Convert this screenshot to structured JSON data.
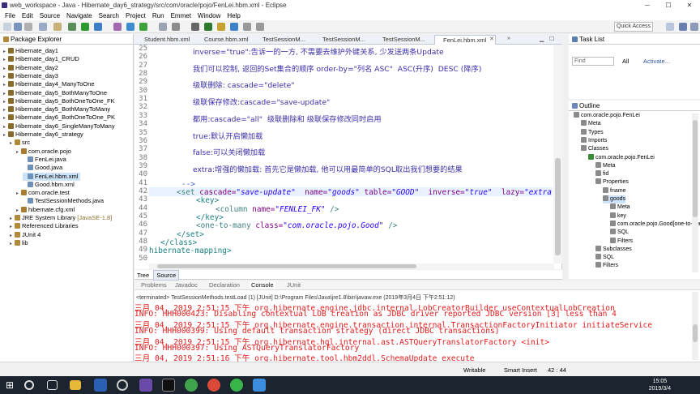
{
  "window": {
    "title": "web_workspace - Java - Hibernate_day6_strategy/src/com/oracle/pojo/FenLei.hbm.xml - Eclipse"
  },
  "menu": [
    "File",
    "Edit",
    "Source",
    "Navigate",
    "Search",
    "Project",
    "Run",
    "Emmet",
    "Window",
    "Help"
  ],
  "toolbar": {
    "quick_access": "Quick Access"
  },
  "package_explorer": {
    "title": "Package Explorer",
    "items": [
      {
        "label": "Hibernate_day1",
        "level": 0
      },
      {
        "label": "Hibernate_day1_CRUD",
        "level": 0
      },
      {
        "label": "Hibernate_day2",
        "level": 0
      },
      {
        "label": "Hibernate_day3",
        "level": 0
      },
      {
        "label": "Hibernate_day4_ManyToOne",
        "level": 0
      },
      {
        "label": "Hibernate_day5_BothManyToOne",
        "level": 0
      },
      {
        "label": "Hibernate_day5_BothOneToOne_FK",
        "level": 0
      },
      {
        "label": "Hibernate_day5_BothManyToMany",
        "level": 0
      },
      {
        "label": "Hibernate_day6_BothOneToOne_PK",
        "level": 0
      },
      {
        "label": "Hibernate_day6_SingleManyToMany",
        "level": 0
      },
      {
        "label": "Hibernate_day6_strategy",
        "level": 0
      },
      {
        "label": "src",
        "level": 1
      },
      {
        "label": "com.oracle.pojo",
        "level": 2
      },
      {
        "label": "FenLei.java",
        "level": 3
      },
      {
        "label": "Good.java",
        "level": 3
      },
      {
        "label": "FenLei.hbm.xml",
        "level": 3
      },
      {
        "label": "Good.hbm.xml",
        "level": 3
      },
      {
        "label": "com.oracle.test",
        "level": 2
      },
      {
        "label": "TestSessionMethods.java",
        "level": 3
      },
      {
        "label": "hibernate.cfg.xml",
        "level": 2
      },
      {
        "label": "JRE System Library",
        "suffix": "[JavaSE-1.8]",
        "level": 1
      },
      {
        "label": "Referenced Libraries",
        "level": 1
      },
      {
        "label": "JUnit 4",
        "level": 1
      },
      {
        "label": "lib",
        "level": 1
      }
    ]
  },
  "editor": {
    "tabs": [
      "Student.hbm.xml",
      "Course.hbm.xml",
      "TestSessionM...",
      "TestSessionM...",
      "TestSessionM...",
      "FenLei.hbm.xml"
    ],
    "lines": [
      {
        "n": "25",
        "text": "inverse=\"true\":告诉一的一方, 不需要去维护外键关系, 少发送两条Update"
      },
      {
        "n": "26",
        "text": ""
      },
      {
        "n": "27",
        "text": "我们可以控制, 返回的Set集合的顺序 order-by=\"列名 ASC\"  ASC(升序)  DESC (降序)"
      },
      {
        "n": "28",
        "text": ""
      },
      {
        "n": "29",
        "text": "级联删除: cascade=\"delete\""
      },
      {
        "n": "30",
        "text": ""
      },
      {
        "n": "31",
        "text": "级联保存修改:cascade=\"save-update\""
      },
      {
        "n": "32",
        "text": ""
      },
      {
        "n": "33",
        "text": "都用:cascade=\"all\"  级联删除和 级联保存修改同时启用"
      },
      {
        "n": "34",
        "text": ""
      },
      {
        "n": "35",
        "text": "true:默认开启懒加载"
      },
      {
        "n": "36",
        "text": ""
      },
      {
        "n": "37",
        "text": "false:可以关闭懒加载"
      },
      {
        "n": "38",
        "text": ""
      },
      {
        "n": "39",
        "text": "extra:增强的懒加载: 首先它是懒加载, 他可以用最简单的SQL取出我们想要的结果"
      },
      {
        "n": "40",
        "text": ""
      },
      {
        "n": "41",
        "text": "-->"
      },
      {
        "n": "42",
        "text": ""
      },
      {
        "n": "43",
        "text": "<key>"
      },
      {
        "n": "44",
        "text": ""
      },
      {
        "n": "45",
        "text": "</key>"
      },
      {
        "n": "46",
        "text": ""
      },
      {
        "n": "47",
        "text": "</set>"
      },
      {
        "n": "48",
        "text": "</class>"
      },
      {
        "n": "49",
        "text": "hibernate-mapping>"
      },
      {
        "n": "50",
        "text": ""
      }
    ],
    "line42": {
      "open": "<set",
      "a1": "cascade=",
      "v1": "\"save-update\"",
      "a2": "name=",
      "v2": "\"goods\"",
      "a3": "table=",
      "v3": "\"GOOD\"",
      "a4": "inverse=",
      "v4": "\"true\"",
      "a5": "lazy=",
      "v5": "\"extra"
    },
    "line44": {
      "open": "<column",
      "a1": "name=",
      "v1": "\"FENLEI_FK\"",
      "close": "/>"
    },
    "line46": {
      "open": "<one-to-many",
      "a1": "class=",
      "v1": "\"com.oracle.pojo.Good\"",
      "close": "/>"
    },
    "bottom_tabs": [
      "Tree",
      "Source"
    ]
  },
  "task_list": {
    "title": "Task List",
    "find_placeholder": "Find",
    "all": "All",
    "activate": "Activate..."
  },
  "outline": {
    "title": "Outline",
    "items": [
      {
        "label": "com.oracle.pojo.FenLei",
        "level": 0
      },
      {
        "label": "Meta",
        "level": 1
      },
      {
        "label": "Types",
        "level": 1
      },
      {
        "label": "Imports",
        "level": 1
      },
      {
        "label": "Classes",
        "level": 1
      },
      {
        "label": "com.oracle.pojo.FenLei",
        "level": 2
      },
      {
        "label": "Meta",
        "level": 3
      },
      {
        "label": "fid",
        "level": 3
      },
      {
        "label": "Properties",
        "level": 3
      },
      {
        "label": "fname",
        "level": 4
      },
      {
        "label": "goods",
        "level": 4
      },
      {
        "label": "Meta",
        "level": 5
      },
      {
        "label": "key",
        "level": 5
      },
      {
        "label": "com.oracle.pojo.Good[one-to-many]",
        "level": 5
      },
      {
        "label": "SQL",
        "level": 5
      },
      {
        "label": "Filters",
        "level": 5
      },
      {
        "label": "Subclasses",
        "level": 3
      },
      {
        "label": "SQL",
        "level": 3
      },
      {
        "label": "Filters",
        "level": 3
      }
    ]
  },
  "console": {
    "tabs": [
      "Problems",
      "Javadoc",
      "Declaration",
      "Console",
      "JUnit"
    ],
    "terminated": "<terminated> TestSessionMethods.testLoad (1) [JUnit] D:\\Program Files\\Java\\jre1.8\\bin\\javaw.exe (2019年3月4日 下午2:51:12)",
    "lines": [
      "三月 04, 2019 2:51:15 下午 org.hibernate.engine.jdbc.internal.LobCreatorBuilder useContextualLobCreation",
      "INFO: HHH000423: Disabling contextual LOB creation as JDBC driver reported JDBC version [3] less than 4",
      "三月 04, 2019 2:51:15 下午 org.hibernate.engine.transaction.internal.TransactionFactoryInitiator initiateService",
      "INFO: HHH000399: Using default transaction strategy (direct JDBC transactions)",
      "三月 04, 2019 2:51:15 下午 org.hibernate.hql.internal.ast.ASTQueryTranslatorFactory <init>",
      "INFO: HHH000397: Using ASTQueryTranslatorFactory",
      "三月 04, 2019 2:51:16 下午 org.hibernate.tool.hbm2ddl.SchemaUpdate execute"
    ]
  },
  "status": {
    "writable": "Writable",
    "insert": "Smart Insert",
    "position": "42 : 44"
  },
  "taskbar": {
    "time": "15:05",
    "date": "2019/3/4"
  },
  "colors": {
    "accent": "#3399ff",
    "console_red": "#e01c1c",
    "code_purple": "#3a00a0",
    "tag_teal": "#1a7f82"
  }
}
